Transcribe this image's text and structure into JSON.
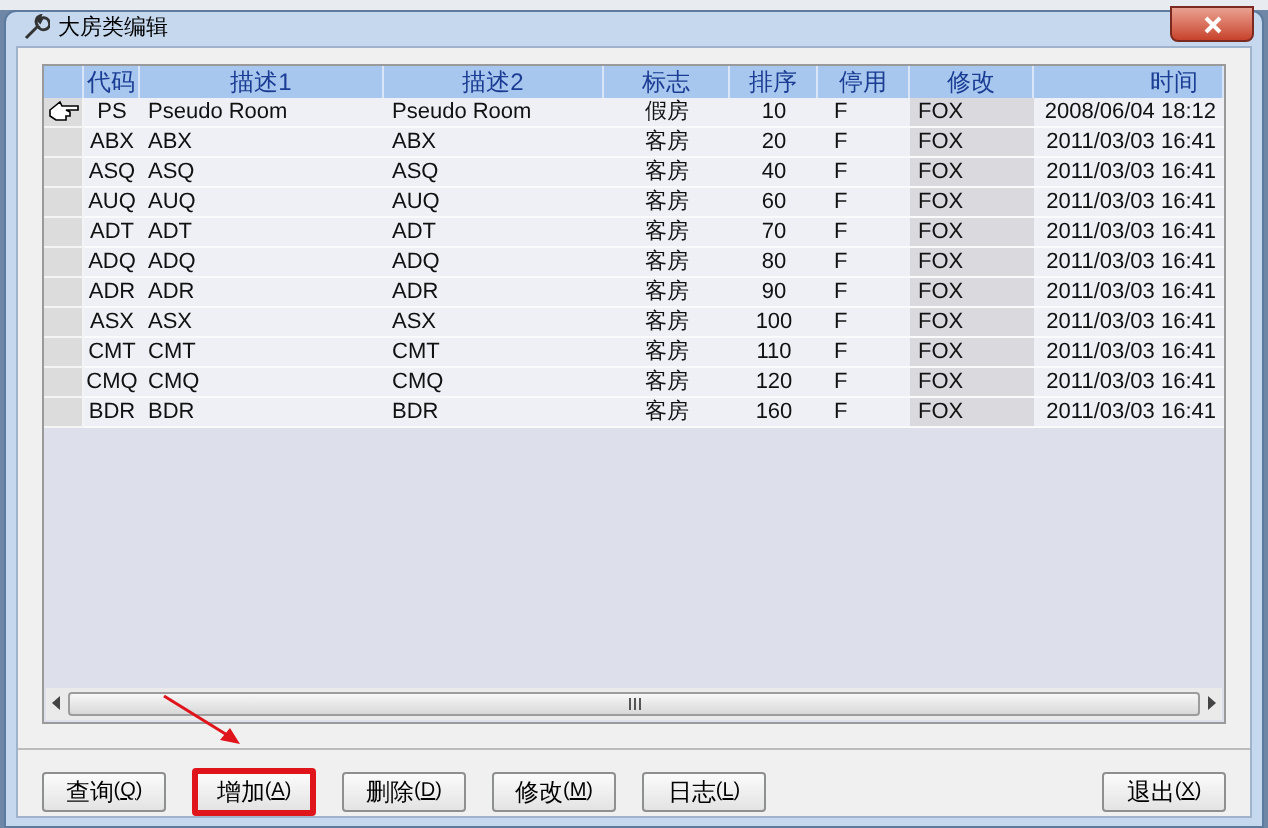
{
  "window": {
    "title": "大房类编辑"
  },
  "table": {
    "columns": [
      {
        "label": "代码",
        "shaded": false
      },
      {
        "label": "描述1",
        "shaded": false
      },
      {
        "label": "描述2",
        "shaded": false
      },
      {
        "label": "标志",
        "shaded": false
      },
      {
        "label": "排序",
        "shaded": false
      },
      {
        "label": "停用",
        "shaded": false
      },
      {
        "label": "修改",
        "shaded": true
      },
      {
        "label": "时间",
        "shaded": false
      }
    ],
    "rows": [
      {
        "current": true,
        "cells": [
          "PS",
          "Pseudo Room",
          "Pseudo Room",
          "假房",
          "10",
          "F",
          "FOX",
          "2008/06/04 18:12"
        ]
      },
      {
        "current": false,
        "cells": [
          "ABX",
          "ABX",
          "ABX",
          "客房",
          "20",
          "F",
          "FOX",
          "2011/03/03 16:41"
        ]
      },
      {
        "current": false,
        "cells": [
          "ASQ",
          "ASQ",
          "ASQ",
          "客房",
          "40",
          "F",
          "FOX",
          "2011/03/03 16:41"
        ]
      },
      {
        "current": false,
        "cells": [
          "AUQ",
          "AUQ",
          "AUQ",
          "客房",
          "60",
          "F",
          "FOX",
          "2011/03/03 16:41"
        ]
      },
      {
        "current": false,
        "cells": [
          "ADT",
          "ADT",
          "ADT",
          "客房",
          "70",
          "F",
          "FOX",
          "2011/03/03 16:41"
        ]
      },
      {
        "current": false,
        "cells": [
          "ADQ",
          "ADQ",
          "ADQ",
          "客房",
          "80",
          "F",
          "FOX",
          "2011/03/03 16:41"
        ]
      },
      {
        "current": false,
        "cells": [
          "ADR",
          "ADR",
          "ADR",
          "客房",
          "90",
          "F",
          "FOX",
          "2011/03/03 16:41"
        ]
      },
      {
        "current": false,
        "cells": [
          "ASX",
          "ASX",
          "ASX",
          "客房",
          "100",
          "F",
          "FOX",
          "2011/03/03 16:41"
        ]
      },
      {
        "current": false,
        "cells": [
          "CMT",
          "CMT",
          "CMT",
          "客房",
          "110",
          "F",
          "FOX",
          "2011/03/03 16:41"
        ]
      },
      {
        "current": false,
        "cells": [
          "CMQ",
          "CMQ",
          "CMQ",
          "客房",
          "120",
          "F",
          "FOX",
          "2011/03/03 16:41"
        ]
      },
      {
        "current": false,
        "cells": [
          "BDR",
          "BDR",
          "BDR",
          "客房",
          "160",
          "F",
          "FOX",
          "2011/03/03 16:41"
        ]
      }
    ]
  },
  "buttons": [
    {
      "label": "查询",
      "hotkey": "(Q)",
      "highlighted": false
    },
    {
      "label": "增加",
      "hotkey": "(A)",
      "highlighted": true
    },
    {
      "label": "删除",
      "hotkey": "(D)",
      "highlighted": false
    },
    {
      "label": "修改",
      "hotkey": "(M)",
      "highlighted": false
    },
    {
      "label": "日志",
      "hotkey": "(L)",
      "highlighted": false
    },
    {
      "label": "退出",
      "hotkey": "(X)",
      "highlighted": false
    }
  ]
}
